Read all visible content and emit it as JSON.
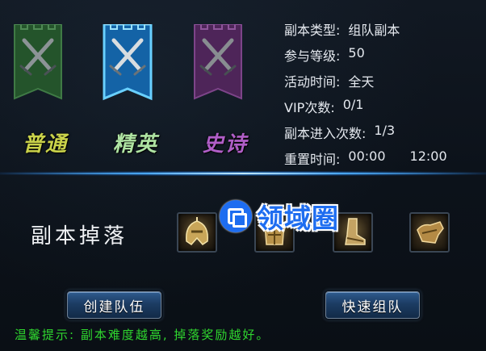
{
  "difficulties": [
    {
      "label": "普通",
      "color": "#c9d24a",
      "banner_color": "#2e6b34",
      "selected": false
    },
    {
      "label": "精英",
      "color": "#aee3a2",
      "banner_color": "#1f7fc4",
      "selected": true
    },
    {
      "label": "史诗",
      "color": "#b05ec7",
      "banner_color": "#6b2f78",
      "selected": false
    }
  ],
  "info": {
    "type_label": "副本类型:",
    "type_value": "组队副本",
    "level_label": "参与等级:",
    "level_value": "50",
    "time_label": "活动时间:",
    "time_value": "全天",
    "vip_label": "VIP次数:",
    "vip_value": "0/1",
    "entries_label": "副本进入次数:",
    "entries_value": "1/3",
    "reset_label": "重置时间:",
    "reset_value_1": "00:00",
    "reset_value_2": "12:00"
  },
  "drops": {
    "title": "副本掉落",
    "items": [
      "helmet-icon",
      "chest-armor-icon",
      "boots-icon",
      "gauntlet-icon"
    ]
  },
  "watermark": "领域圈",
  "buttons": {
    "create_team": "创建队伍",
    "quick_team": "快速组队"
  },
  "tip": "温馨提示: 副本难度越高, 掉落奖励越好。"
}
